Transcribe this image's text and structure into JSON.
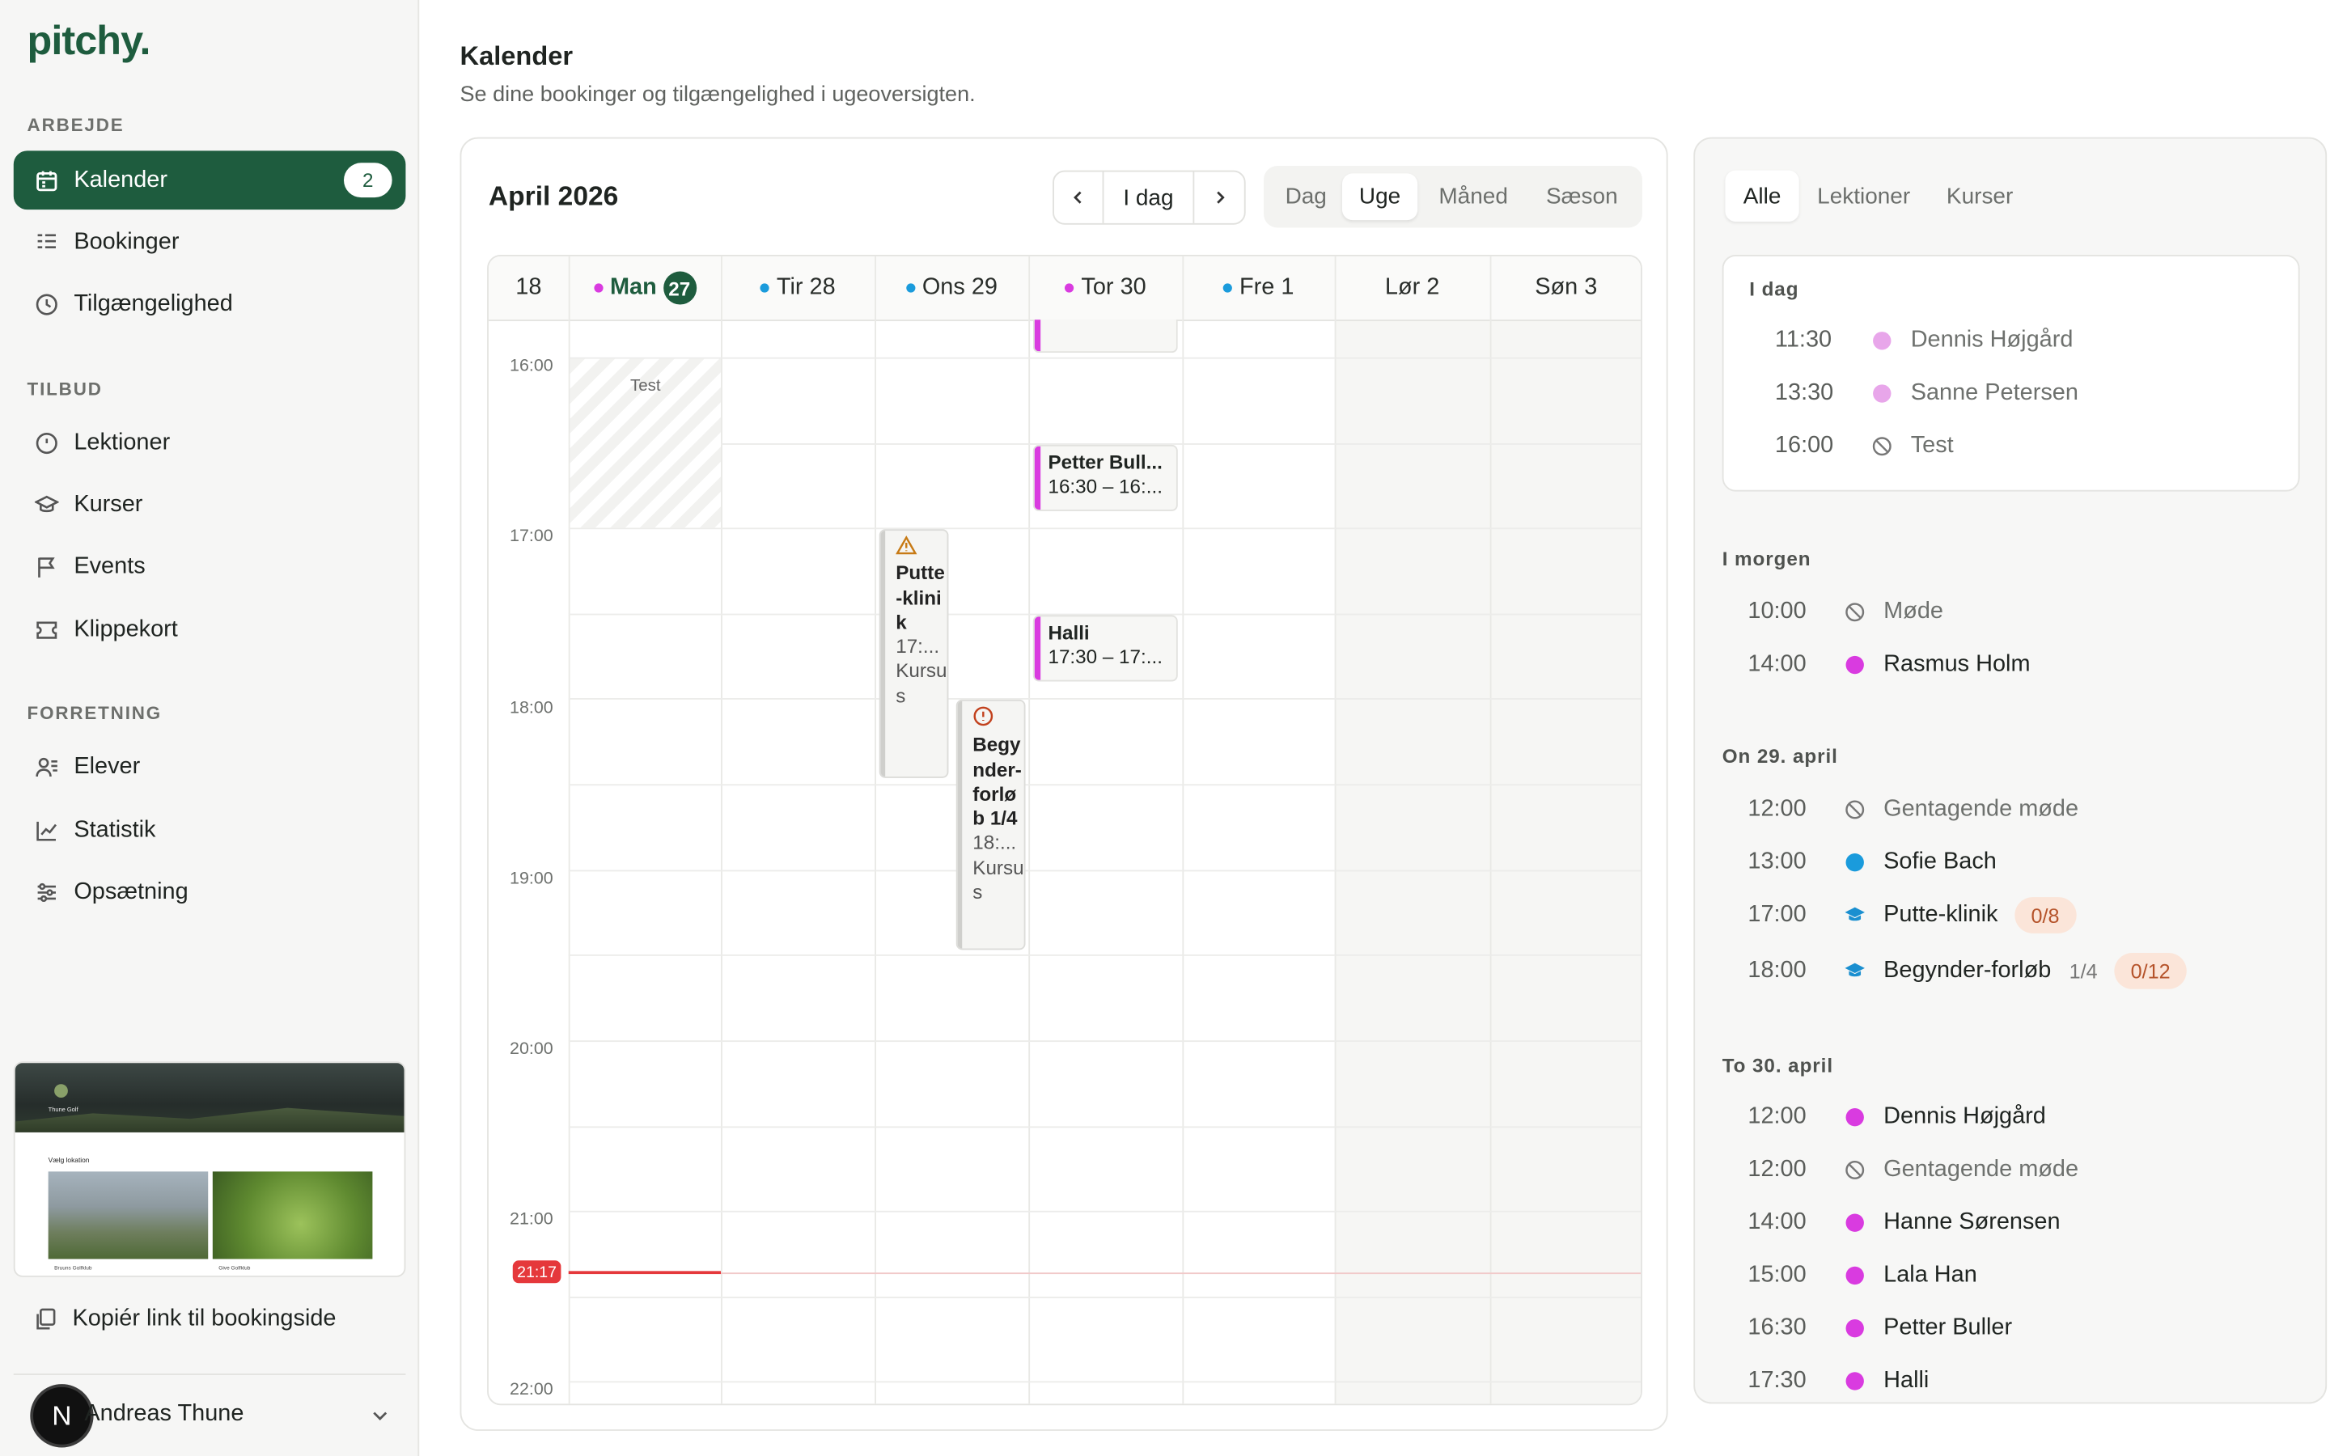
{
  "app": {
    "logo": "pitchy",
    "logo_dot": "."
  },
  "sidebar": {
    "sections": [
      {
        "label": "ARBEJDE"
      },
      {
        "label": "TILBUD"
      },
      {
        "label": "FORRETNING"
      }
    ],
    "items": [
      {
        "label": "Kalender",
        "badge": "2",
        "icon": "calendar-icon",
        "active": true
      },
      {
        "label": "Bookinger",
        "icon": "list-icon"
      },
      {
        "label": "Tilgængelighed",
        "icon": "clock-icon"
      },
      {
        "label": "Lektioner",
        "icon": "timer-icon"
      },
      {
        "label": "Kurser",
        "icon": "graduation-cap-icon"
      },
      {
        "label": "Events",
        "icon": "flag-icon"
      },
      {
        "label": "Klippekort",
        "icon": "ticket-icon"
      },
      {
        "label": "Elever",
        "icon": "users-icon"
      },
      {
        "label": "Statistik",
        "icon": "chart-line-icon"
      },
      {
        "label": "Opsætning",
        "icon": "sliders-icon"
      }
    ],
    "preview": {
      "brand": "Thune Golf",
      "heading": "Vælg lokation",
      "caption1": "Bruuns Golfklub",
      "caption2": "Give Golfklub"
    },
    "copy_link": "Kopiér link til bookingside",
    "user": {
      "initial": "N",
      "name": "Andreas Thune"
    }
  },
  "header": {
    "title": "Kalender",
    "subtitle": "Se dine bookinger og tilgængelighed i ugeoversigten."
  },
  "calendar": {
    "month": "April 2026",
    "today_label": "I dag",
    "views": [
      "Dag",
      "Uge",
      "Måned",
      "Sæson"
    ],
    "selected_view": "Uge",
    "week_number": "18",
    "days": [
      {
        "label": "Man",
        "num": "27",
        "today": true,
        "dot": "#d93be0"
      },
      {
        "label": "Tir 28",
        "dot": "#1a9bdc"
      },
      {
        "label": "Ons 29",
        "dot": "#1a9bdc"
      },
      {
        "label": "Tor 30",
        "dot": "#d93be0"
      },
      {
        "label": "Fre 1",
        "dot": "#1a9bdc"
      },
      {
        "label": "Lør 2"
      },
      {
        "label": "Søn 3"
      }
    ],
    "hours": [
      "16:00",
      "17:00",
      "18:00",
      "19:00",
      "20:00",
      "21:00",
      "22:00"
    ],
    "now": "21:17",
    "blocked": {
      "label": "Test"
    },
    "events": [
      {
        "title": "Petter Bull...",
        "time": "16:30 – 16:..."
      },
      {
        "title": "Halli",
        "time": "17:30 – 17:..."
      }
    ],
    "courses": [
      {
        "title": "Putte-klinik",
        "time": "17:...",
        "kind": "Kursus"
      },
      {
        "title": "Begynder-forløb 1/4",
        "time": "18:...",
        "kind": "Kursus"
      }
    ]
  },
  "agenda": {
    "tabs": [
      "Alle",
      "Lektioner",
      "Kurser"
    ],
    "selected_tab": "Alle",
    "groups": [
      {
        "label": "I dag",
        "rows": [
          {
            "time": "11:30",
            "name": "Dennis Højgård",
            "mark": "dot",
            "color": "#e8a6ea"
          },
          {
            "time": "13:30",
            "name": "Sanne Petersen",
            "mark": "dot",
            "color": "#e8a6ea"
          },
          {
            "time": "16:00",
            "name": "Test",
            "mark": "ban-icon"
          }
        ]
      },
      {
        "label": "I morgen",
        "rows": [
          {
            "time": "10:00",
            "name": "Møde",
            "mark": "ban-icon"
          },
          {
            "time": "14:00",
            "name": "Rasmus Holm",
            "mark": "dot",
            "color": "#d93be0"
          }
        ]
      },
      {
        "label": "On 29. april",
        "rows": [
          {
            "time": "12:00",
            "name": "Gentagende møde",
            "mark": "ban-icon"
          },
          {
            "time": "13:00",
            "name": "Sofie Bach",
            "mark": "dot",
            "color": "#1a9bdc"
          },
          {
            "time": "17:00",
            "name": "Putte-klinik",
            "mark": "graduation-cap-icon",
            "pill": "0/8"
          },
          {
            "time": "18:00",
            "name": "Begynder-forløb",
            "mark": "graduation-cap-icon",
            "extra": "1/4",
            "pill": "0/12"
          }
        ]
      },
      {
        "label": "To 30. april",
        "rows": [
          {
            "time": "12:00",
            "name": "Dennis Højgård",
            "mark": "dot",
            "color": "#d93be0"
          },
          {
            "time": "12:00",
            "name": "Gentagende møde",
            "mark": "ban-icon"
          },
          {
            "time": "14:00",
            "name": "Hanne Sørensen",
            "mark": "dot",
            "color": "#d93be0"
          },
          {
            "time": "15:00",
            "name": "Lala Han",
            "mark": "dot",
            "color": "#d93be0"
          },
          {
            "time": "16:30",
            "name": "Petter Buller",
            "mark": "dot",
            "color": "#d93be0"
          },
          {
            "time": "17:30",
            "name": "Halli",
            "mark": "dot",
            "color": "#d93be0"
          }
        ]
      }
    ]
  }
}
